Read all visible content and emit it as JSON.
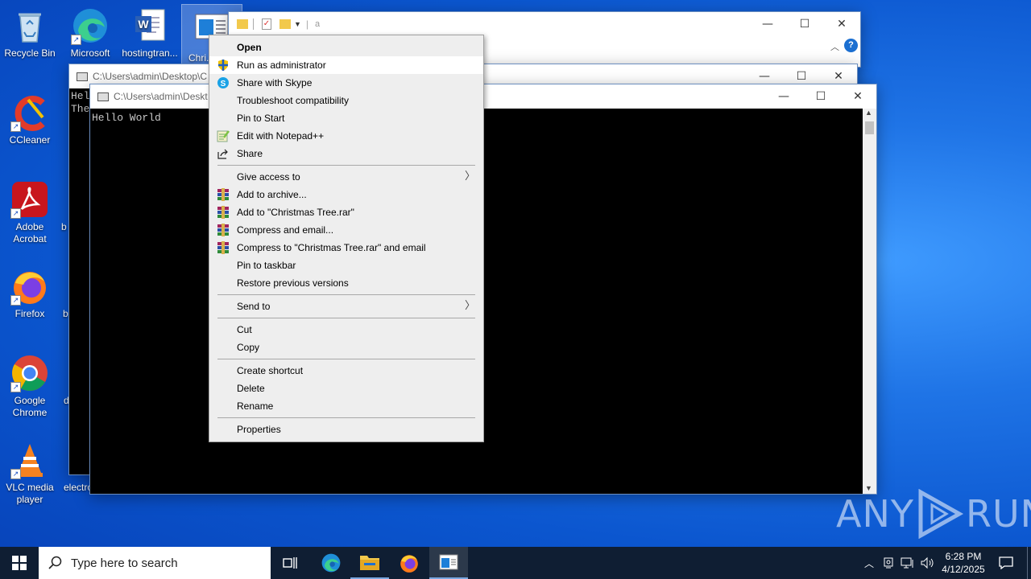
{
  "desktop": {
    "icons": [
      {
        "label": "Recycle Bin"
      },
      {
        "label": "Microsoft Edge"
      },
      {
        "label": "hostingtran..."
      },
      {
        "label": "Chri..."
      },
      {
        "label": "CCleaner"
      },
      {
        "label": "Adobe Acrobat"
      },
      {
        "label": "Firefox"
      },
      {
        "label": "Google Chrome"
      },
      {
        "label": "VLC media player"
      }
    ],
    "partial_labels": [
      "b",
      "b",
      "d",
      "electro"
    ]
  },
  "explorer": {
    "address": "a"
  },
  "console1": {
    "title": "C:\\Users\\admin\\Desktop\\C",
    "lines": [
      "Hel",
      "The"
    ]
  },
  "console2": {
    "title": "C:\\Users\\admin\\Deskt",
    "output": "Hello World"
  },
  "window_controls": {
    "minimize": "—",
    "maximize": "☐",
    "close": "✕"
  },
  "context_menu": {
    "items": [
      {
        "label": "Open"
      },
      {
        "label": "Run as administrator"
      },
      {
        "label": "Share with Skype"
      },
      {
        "label": "Troubleshoot compatibility"
      },
      {
        "label": "Pin to Start"
      },
      {
        "label": "Edit with Notepad++"
      },
      {
        "label": "Share"
      },
      {
        "label": "Give access to"
      },
      {
        "label": "Add to archive..."
      },
      {
        "label": "Add to \"Christmas Tree.rar\""
      },
      {
        "label": "Compress and email..."
      },
      {
        "label": "Compress to \"Christmas Tree.rar\" and email"
      },
      {
        "label": "Pin to taskbar"
      },
      {
        "label": "Restore previous versions"
      },
      {
        "label": "Send to"
      },
      {
        "label": "Cut"
      },
      {
        "label": "Copy"
      },
      {
        "label": "Create shortcut"
      },
      {
        "label": "Delete"
      },
      {
        "label": "Rename"
      },
      {
        "label": "Properties"
      }
    ]
  },
  "taskbar": {
    "search_placeholder": "Type here to search",
    "time": "6:28 PM",
    "date": "4/12/2025"
  },
  "watermark": {
    "text_left": "ANY",
    "text_right": "RUN"
  },
  "colors": {
    "desktop": "#0b56cf",
    "taskbar": "#0f1e33",
    "menu_bg": "#eeeeee",
    "menu_hover": "#ffffff"
  }
}
